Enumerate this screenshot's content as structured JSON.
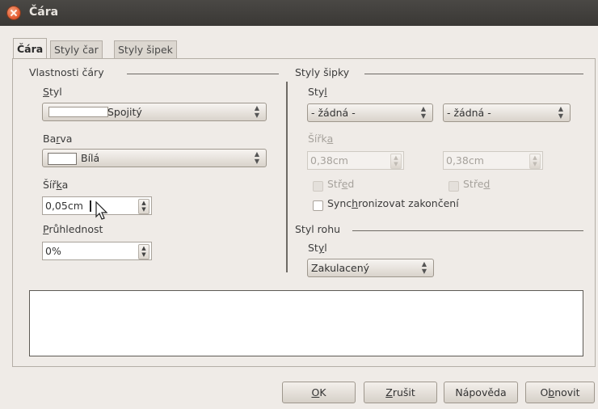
{
  "window": {
    "title": "Čára"
  },
  "tabs": [
    {
      "label": "Čára"
    },
    {
      "label": "Styly čar"
    },
    {
      "label": "Styly šipek"
    }
  ],
  "line_properties": {
    "section_title": "Vlastnosti čáry",
    "style_label": "Styl",
    "style_value": "Spojitý",
    "color_label": "Barva",
    "color_value": "Bílá",
    "color_swatch": "#ffffff",
    "width_label": "Šířka",
    "width_value": "0,05cm",
    "transparency_label": "Průhlednost",
    "transparency_value": "0%"
  },
  "arrow_styles": {
    "section_title": "Styly šipky",
    "style_label": "Styl",
    "start_style": "- žádná -",
    "end_style": "- žádná -",
    "width_label": "Šířka",
    "start_width": "0,38cm",
    "end_width": "0,38cm",
    "start_center_label": "Střed",
    "end_center_label": "Střed",
    "sync_label": "Synchronizovat zakončení"
  },
  "corner_style": {
    "section_title": "Styl rohu",
    "style_label": "Styl",
    "style_value": "Zakulacený"
  },
  "buttons": {
    "ok": "OK",
    "cancel": "Zrušit",
    "help": "Nápověda",
    "reset": "Obnovit"
  }
}
